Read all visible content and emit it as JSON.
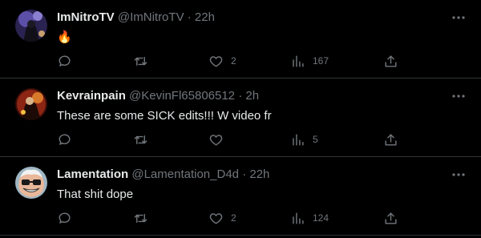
{
  "tweets": [
    {
      "name": "ImNitroTV",
      "handle": "@ImNitroTV",
      "separator": "·",
      "time": "22h",
      "text": "🔥",
      "likes": "2",
      "views": "167",
      "avatar_icon": "dark-figure-avatar"
    },
    {
      "name": "Kevrainpain",
      "handle": "@KevinFl65806512",
      "separator": "·",
      "time": "2h",
      "text": "These are some SICK edits!!! W video fr",
      "likes": "",
      "views": "5",
      "avatar_icon": "red-figure-avatar"
    },
    {
      "name": "Lamentation",
      "handle": "@Lamentation_D4d",
      "separator": "·",
      "time": "22h",
      "text": "That shit dope",
      "likes": "2",
      "views": "124",
      "avatar_icon": "sunglasses-face-avatar"
    }
  ],
  "colors": {
    "background": "#000000",
    "text": "#e7e9ea",
    "secondary": "#71767b",
    "divider": "#2f3336"
  }
}
